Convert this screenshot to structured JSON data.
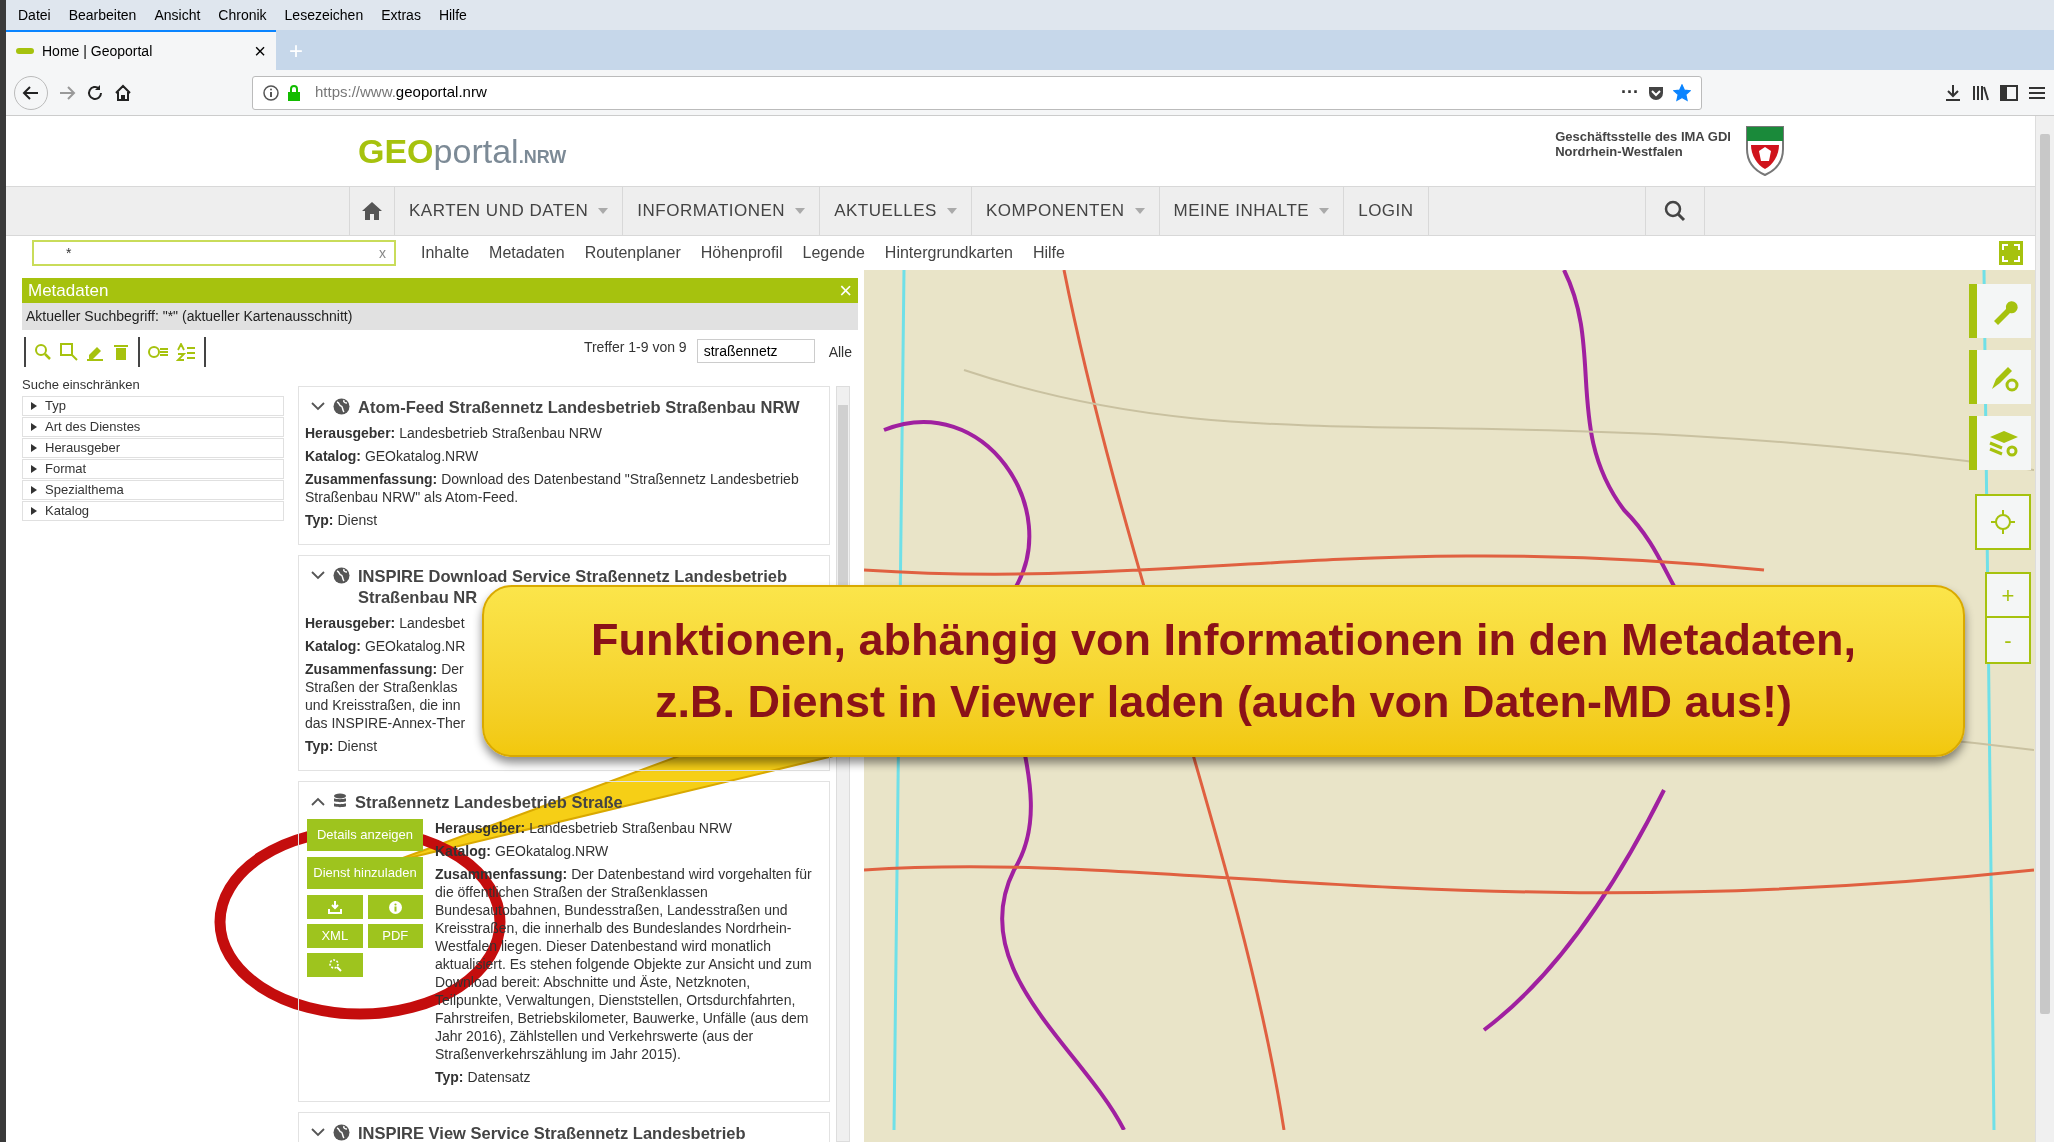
{
  "browser": {
    "menu": [
      "Datei",
      "Bearbeiten",
      "Ansicht",
      "Chronik",
      "Lesezeichen",
      "Extras",
      "Hilfe"
    ],
    "tabs": [
      {
        "title": "Home | Geoportal",
        "close": "×",
        "selected": true
      }
    ],
    "new_tab": "+",
    "url": {
      "prefix": "https://www.",
      "host": "geoportal.nrw"
    },
    "page_actions": "···",
    "bookmarked": true
  },
  "header": {
    "logo": {
      "geo": "GEO",
      "portal": "portal",
      "suffix": ".NRW"
    },
    "org_lines": [
      "Geschäftsstelle des IMA GDI",
      "Nordrhein-Westfalen"
    ]
  },
  "nav": [
    {
      "label": "KARTEN UND DATEN",
      "dropdown": true
    },
    {
      "label": "INFORMATIONEN",
      "dropdown": true
    },
    {
      "label": "AKTUELLES",
      "dropdown": true
    },
    {
      "label": "KOMPONENTEN",
      "dropdown": true
    },
    {
      "label": "MEINE INHALTE",
      "dropdown": true
    },
    {
      "label": "LOGIN",
      "dropdown": false
    }
  ],
  "search": {
    "value": "*",
    "clear": "x"
  },
  "subnav": [
    "Inhalte",
    "Metadaten",
    "Routenplaner",
    "Höhenprofil",
    "Legende",
    "Hintergrundkarten",
    "Hilfe"
  ],
  "metadata_panel": {
    "title": "Metadaten",
    "close": "×",
    "search_term": "Aktueller Suchbegriff: \"*\" (aktueller Kartenausschnitt)",
    "hits": "Treffer 1-9 von 9",
    "filter_value": "straßennetz",
    "all": "Alle",
    "facets_title": "Suche einschränken",
    "facets": [
      "Typ",
      "Art des Dienstes",
      "Herausgeber",
      "Format",
      "Spezialthema",
      "Katalog"
    ],
    "results": [
      {
        "kind": "service",
        "expanded": false,
        "title_lines": [
          "Atom-Feed Straßennetz Landesbetrieb Straßenbau NRW"
        ],
        "fields": [
          {
            "label": "Herausgeber:",
            "value": "Landesbetrieb Straßenbau NRW"
          },
          {
            "label": "Katalog:",
            "value": "GEOkatalog.NRW"
          },
          {
            "label": "Zusammenfassung:",
            "value": "Download des Datenbestand \"Straßennetz Landesbetrieb Straßenbau NRW\" als Atom-Feed."
          },
          {
            "label": "Typ:",
            "value": "Dienst"
          }
        ]
      },
      {
        "kind": "service",
        "expanded": false,
        "title_lines": [
          "INSPIRE Download Service Straßennetz Landesbetrieb",
          "Straßenbau NR"
        ],
        "fields": [
          {
            "label": "Herausgeber:",
            "value": "Landesbet"
          },
          {
            "label": "Katalog:",
            "value": "GEOkatalog.NR"
          },
          {
            "label": "Zusammenfassung:",
            "value": "Der",
            "more_lines": [
              "Straßen der Straßenklas",
              "und Kreisstraßen, die inn",
              "das INSPIRE-Annex-Ther"
            ]
          },
          {
            "label": "Typ:",
            "value": "Dienst"
          }
        ]
      },
      {
        "kind": "dataset",
        "expanded": true,
        "title_lines": [
          "Straßennetz Landesbetrieb Straße"
        ],
        "actions": [
          {
            "kind": "text",
            "label": "Details anzeigen"
          },
          {
            "kind": "text",
            "label": "Dienst hinzuladen"
          }
        ],
        "small_actions": [
          {
            "kind": "download"
          },
          {
            "kind": "info"
          },
          {
            "kind": "text",
            "label": "XML"
          },
          {
            "kind": "text",
            "label": "PDF"
          },
          {
            "kind": "zoom"
          }
        ],
        "fields": [
          {
            "label": "Herausgeber:",
            "value": "Landesbetrieb Straßenbau NRW"
          },
          {
            "label": "Katalog:",
            "value": "GEOkatalog.NRW"
          },
          {
            "label": "Zusammenfassung:",
            "value": "Der Datenbestand wird vorgehalten für die öffentlichen Straßen der Straßenklassen Bundesautobahnen, Bundesstraßen, Landesstraßen und Kreisstraßen, die innerhalb des Bundeslandes Nordrhein-Westfalen liegen. Dieser Datenbestand wird monatlich aktualisiert. Es stehen folgende Objekte zur Ansicht und zum Download bereit: Abschnitte und Äste, Netzknoten, Teilpunkte, Verwaltungen, Dienststellen, Ortsdurchfahrten, Fahrstreifen, Betriebskilometer, Bauwerke, Unfälle (aus dem Jahr 2016), Zählstellen und Verkehrswerte (aus der Straßenverkehrszählung im Jahr 2015)."
          },
          {
            "label": "Typ:",
            "value": "Datensatz"
          }
        ]
      },
      {
        "kind": "service",
        "expanded": false,
        "title_lines": [
          "INSPIRE View Service Straßennetz Landesbetrieb"
        ]
      }
    ]
  },
  "map_controls": {
    "zoom_in": "+",
    "zoom_out": "-"
  },
  "callout": {
    "lines": [
      "Funktionen, abhängig von Informationen in den Metadaten,",
      "z.B. Dienst in Viewer laden (auch von Daten-MD aus!)"
    ]
  }
}
